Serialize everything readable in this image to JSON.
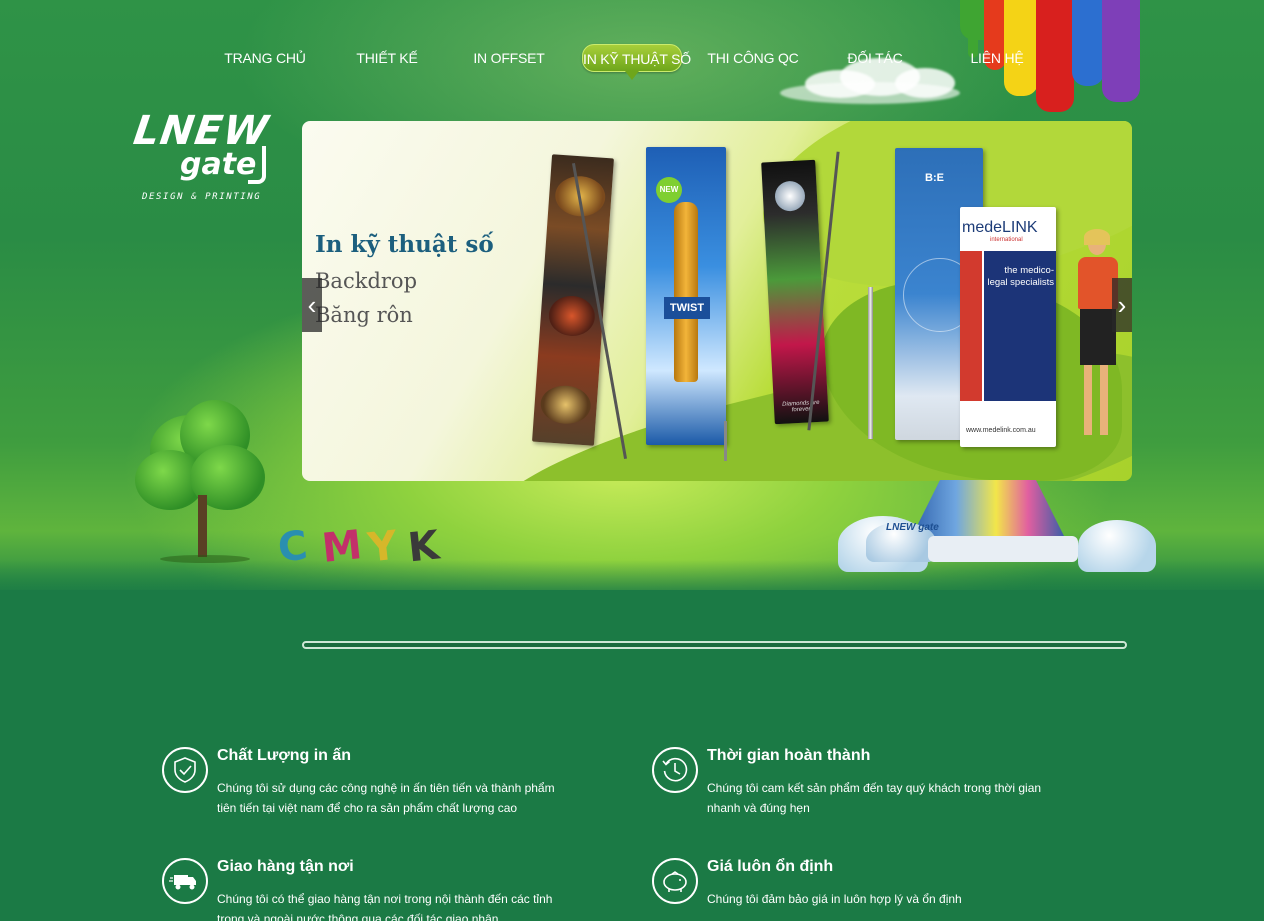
{
  "nav": {
    "items": [
      {
        "label": "TRANG CHỦ"
      },
      {
        "label": "THIẾT KẾ"
      },
      {
        "label": "IN OFFSET"
      },
      {
        "label": "IN KỸ THUẬT SỐ"
      },
      {
        "label": "THI CÔNG QC"
      },
      {
        "label": "ĐỐI TÁC"
      },
      {
        "label": "LIÊN HỆ"
      }
    ],
    "active_index": 3
  },
  "logo": {
    "line1": "LNEW",
    "line2": "gate",
    "tagline": "DESIGN & PRINTING"
  },
  "slider": {
    "title": "In kỹ thuật số",
    "lines": [
      "Backdrop",
      "Băng rôn"
    ],
    "prev_icon": "chevron-left-icon",
    "next_icon": "chevron-right-icon",
    "banners": {
      "b2_label": "NEW",
      "b2_brand": "TWIST",
      "b4_brand": "B:E",
      "b5_brand": "medeLINK",
      "b5_sub": "international",
      "b5_text": "the medico-legal specialists",
      "b5_url": "www.medelink.com.au",
      "b3_text": "Diamonds are forever"
    }
  },
  "decor": {
    "cmyk": [
      "C",
      "M",
      "Y",
      "K"
    ],
    "machine_logo": "LNEW gate"
  },
  "features": [
    {
      "icon": "shield-check-icon",
      "title": "Chất Lượng in ấn",
      "text": "Chúng tôi sử dụng các công nghệ in ấn tiên tiến và thành phẩm tiên tiến tại việt nam để cho ra sản phẩm chất lượng cao"
    },
    {
      "icon": "clock-history-icon",
      "title": "Thời gian hoàn thành",
      "text": "Chúng tôi cam kết sản phẩm đến tay quý khách trong thời gian nhanh và đúng hẹn"
    },
    {
      "icon": "delivery-truck-icon",
      "title": "Giao hàng tận nơi",
      "text": "Chúng tôi có thể giao hàng tận nơi trong nội thành đến các tỉnh trong và ngoài nước thông qua các đối tác giao nhận"
    },
    {
      "icon": "piggy-bank-icon",
      "title": "Giá luôn ổn định",
      "text": "Chúng tôi đảm bảo giá  in luôn hợp lý và ổn định"
    }
  ],
  "colors": {
    "page_bg": "#1b7a45",
    "slide_title": "#1c5f7e",
    "nav_active": "#8cc02b"
  }
}
